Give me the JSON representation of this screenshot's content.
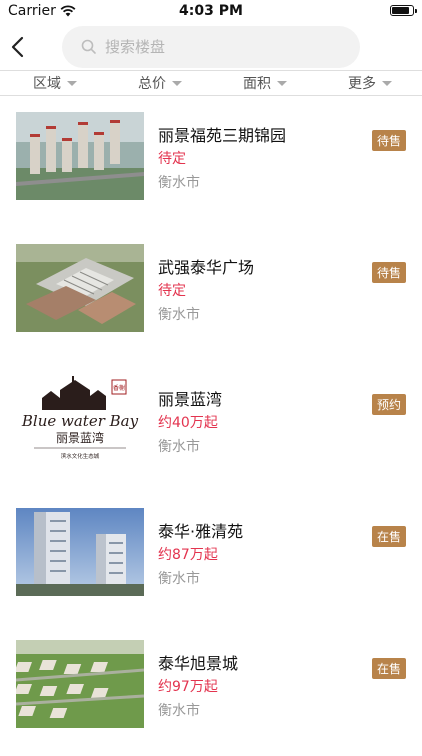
{
  "status_bar": {
    "carrier": "Carrier",
    "time": "4:03 PM"
  },
  "search": {
    "placeholder": "搜索楼盘"
  },
  "filters": [
    "区域",
    "总价",
    "面积",
    "更多"
  ],
  "colors": {
    "price": "#e3344f",
    "tag_bg": "#b8834a"
  },
  "listings": [
    {
      "name": "丽景福苑三期锦园",
      "price": "待定",
      "city": "衡水市",
      "tag": "待售",
      "image": "towers-aerial"
    },
    {
      "name": "武强泰华广场",
      "price": "待定",
      "city": "衡水市",
      "tag": "待售",
      "image": "plaza-aerial"
    },
    {
      "name": "丽景蓝湾",
      "price": "约40万起",
      "city": "衡水市",
      "tag": "预约",
      "image": "blue-water-bay-logo",
      "logo": {
        "seal": "香榭",
        "script": "Blue water Bay",
        "cn": "丽景蓝湾",
        "slogan": "滨水文化生态城"
      }
    },
    {
      "name": "泰华·雅清苑",
      "price": "约87万起",
      "city": "衡水市",
      "tag": "在售",
      "image": "highrise-towers"
    },
    {
      "name": "泰华旭景城",
      "price": "约97万起",
      "city": "衡水市",
      "tag": "在售",
      "image": "green-community-aerial"
    }
  ]
}
